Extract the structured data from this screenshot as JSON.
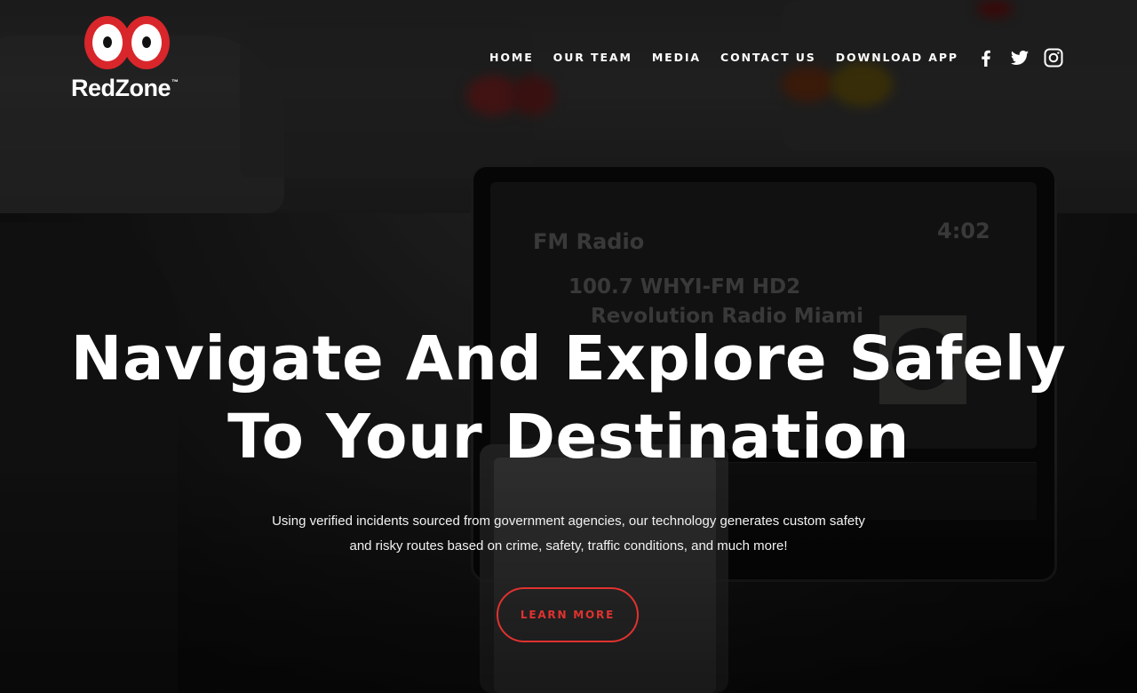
{
  "brand": {
    "name": "RedZone",
    "trademark": "™",
    "logo_color": "#d8262b"
  },
  "nav": {
    "items": [
      {
        "label": "HOME"
      },
      {
        "label": "OUR TEAM"
      },
      {
        "label": "MEDIA"
      },
      {
        "label": "CONTACT US"
      },
      {
        "label": "DOWNLOAD APP"
      }
    ]
  },
  "social": {
    "icons": [
      "facebook-icon",
      "twitter-icon",
      "instagram-icon"
    ]
  },
  "background_screen": {
    "source": "FM Radio",
    "time": "4:02",
    "station": "100.7 WHYI-FM HD2",
    "program": "Revolution Radio Miami"
  },
  "hero": {
    "title_line1": "Navigate And Explore Safely",
    "title_line2": "To Your Destination",
    "subtitle_line1": "Using verified incidents sourced from government agencies, our technology generates custom safety",
    "subtitle_line2": "and risky routes based on crime, safety, traffic conditions, and much more!",
    "cta_label": "LEARN MORE",
    "cta_color": "#e0322f"
  }
}
